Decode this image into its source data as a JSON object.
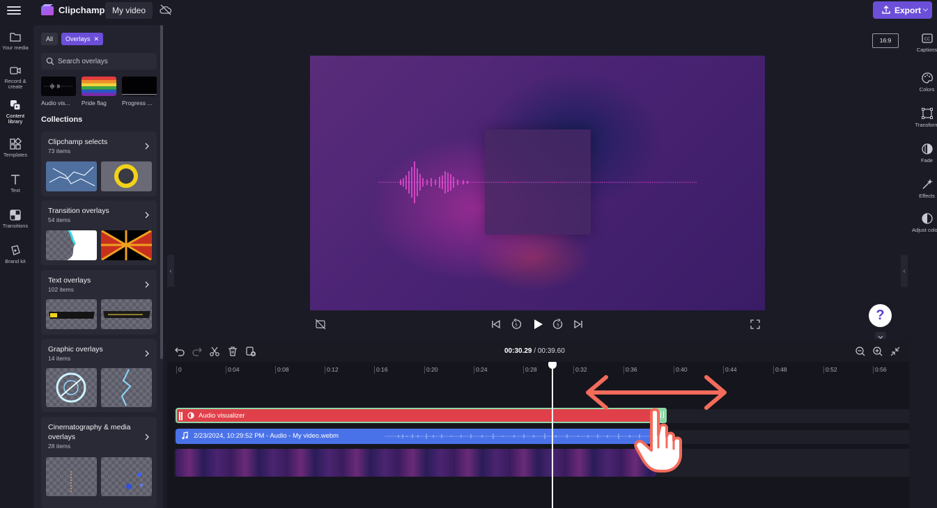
{
  "topbar": {
    "brand": "Clipchamp",
    "project_name": "My video",
    "export_label": "Export"
  },
  "left_rail": [
    {
      "label": "Your media",
      "icon": "folder-icon"
    },
    {
      "label": "Record & create",
      "icon": "camera-icon"
    },
    {
      "label": "Content library",
      "icon": "content-library-icon",
      "active": true
    },
    {
      "label": "Templates",
      "icon": "templates-icon"
    },
    {
      "label": "Text",
      "icon": "text-icon"
    },
    {
      "label": "Transitions",
      "icon": "transitions-icon"
    },
    {
      "label": "Brand kit",
      "icon": "brand-kit-icon"
    }
  ],
  "panel": {
    "filter_all": "All",
    "filter_active": "Overlays",
    "search_placeholder": "Search overlays",
    "overlay_items": [
      {
        "label": "Audio vis..."
      },
      {
        "label": "Pride flag"
      },
      {
        "label": "Progress ..."
      }
    ],
    "collections_title": "Collections",
    "collections": [
      {
        "title": "Clipchamp selects",
        "count": "73 items"
      },
      {
        "title": "Transition overlays",
        "count": "54 items"
      },
      {
        "title": "Text overlays",
        "count": "102 items"
      },
      {
        "title": "Graphic overlays",
        "count": "14 items"
      },
      {
        "title": "Cinematography & media overlays",
        "count": "28 items"
      }
    ]
  },
  "stage": {
    "aspect_ratio": "16:9",
    "help_label": "?"
  },
  "right_rail": [
    {
      "label": "Captions",
      "icon": "captions-icon"
    },
    {
      "label": "Colors",
      "icon": "palette-icon"
    },
    {
      "label": "Transform",
      "icon": "transform-icon"
    },
    {
      "label": "Fade",
      "icon": "fade-icon"
    },
    {
      "label": "Effects",
      "icon": "effects-icon"
    },
    {
      "label": "Adjust colors",
      "icon": "adjust-colors-icon"
    }
  ],
  "timeline": {
    "current_time": "00:30.29",
    "separator": " / ",
    "total_time": "00:39.60",
    "ruler": [
      "0",
      "0:04",
      "0:08",
      "0:12",
      "0:16",
      "0:20",
      "0:24",
      "0:28",
      "0:32",
      "0:36",
      "0:40",
      "0:44",
      "0:48",
      "0:52",
      "0:56"
    ],
    "clips": {
      "audio_visualizer": "Audio visualizer",
      "audio": "2/23/2024, 10:29:52 PM - Audio - My video.webm"
    }
  },
  "colors": {
    "accent": "#6b4fd8",
    "visualizer_clip": "#e0404a",
    "audio_clip": "#4a72e8",
    "clip_selection": "#8ed8a8",
    "annotation_arrow": "#f26b5b"
  }
}
